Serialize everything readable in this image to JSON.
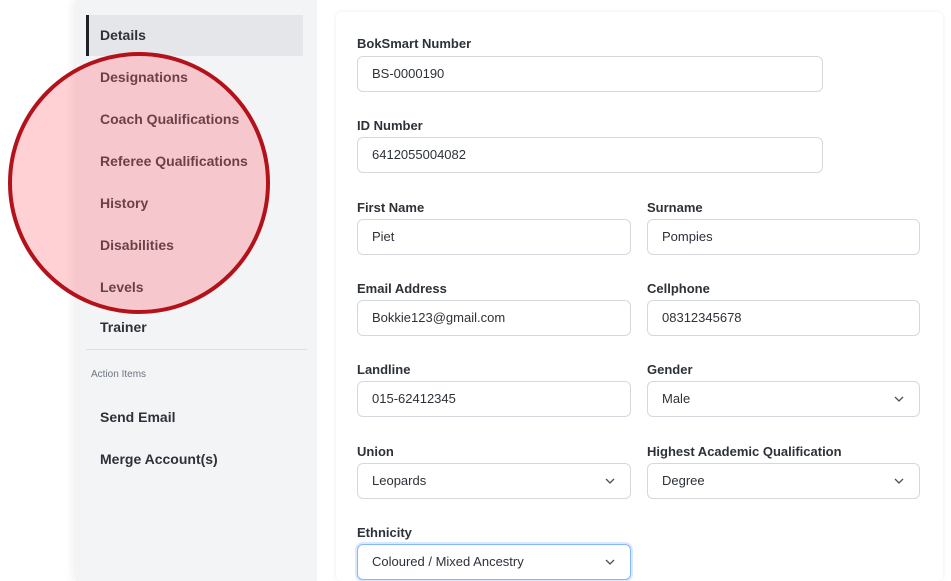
{
  "sidebar": {
    "items": [
      {
        "label": "Details"
      },
      {
        "label": "Designations"
      },
      {
        "label": "Coach Qualifications"
      },
      {
        "label": "Referee Qualifications"
      },
      {
        "label": "History"
      },
      {
        "label": "Disabilities"
      },
      {
        "label": "Levels"
      },
      {
        "label": "Trainer"
      }
    ],
    "section_title": "Action Items",
    "actions": [
      {
        "label": "Send Email"
      },
      {
        "label": "Merge Account(s)"
      }
    ]
  },
  "form": {
    "boksmart": {
      "label": "BokSmart Number",
      "value": "BS-0000190"
    },
    "id_number": {
      "label": "ID Number",
      "value": "6412055004082"
    },
    "first_name": {
      "label": "First Name",
      "value": "Piet"
    },
    "surname": {
      "label": "Surname",
      "value": "Pompies"
    },
    "email": {
      "label": "Email Address",
      "value": "Bokkie123@gmail.com"
    },
    "cellphone": {
      "label": "Cellphone",
      "value": "08312345678"
    },
    "landline": {
      "label": "Landline",
      "value": "015-62412345"
    },
    "gender": {
      "label": "Gender",
      "value": "Male"
    },
    "union": {
      "label": "Union",
      "value": "Leopards"
    },
    "qualification": {
      "label": "Highest Academic Qualification",
      "value": "Degree"
    },
    "ethnicity": {
      "label": "Ethnicity",
      "value": "Coloured / Mixed Ancestry"
    }
  },
  "colors": {
    "highlight_border": "#b3121b",
    "focus_border": "#86b7fe"
  }
}
